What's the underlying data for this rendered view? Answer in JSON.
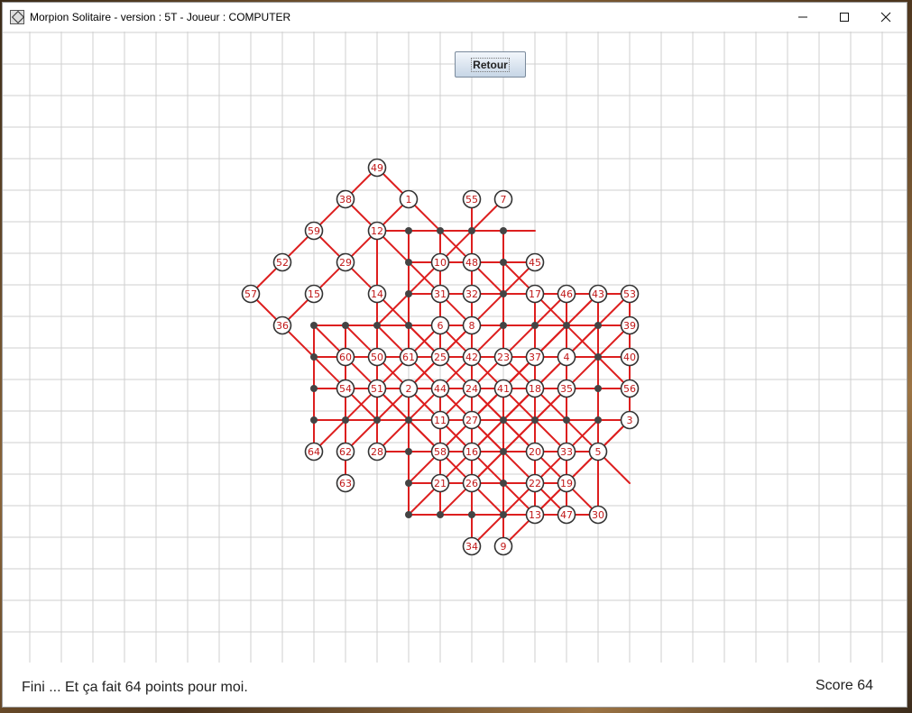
{
  "window": {
    "title": "Morpion Solitaire - version : 5T - Joueur : COMPUTER"
  },
  "toolbar": {
    "retour_label": "Retour"
  },
  "status": {
    "message": "Fini ... Et ça fait 64 points pour moi.",
    "score_text": "Score 64"
  },
  "colors": {
    "grid": "#cfcfcf",
    "line": "#dd1f1f",
    "dot": "#444444",
    "numbered_text": "#c01818",
    "circle_outline": "#333333"
  },
  "board": {
    "initial_dots": [
      [
        7,
        0
      ],
      [
        8,
        0
      ],
      [
        7,
        1
      ],
      [
        6,
        2
      ],
      [
        7,
        2
      ],
      [
        8,
        2
      ],
      [
        5,
        3
      ],
      [
        6,
        3
      ],
      [
        8,
        3
      ],
      [
        9,
        3
      ],
      [
        10,
        3
      ],
      [
        11,
        3
      ],
      [
        0,
        4
      ],
      [
        2,
        4
      ],
      [
        5,
        4
      ],
      [
        11,
        4
      ],
      [
        0,
        5
      ],
      [
        1,
        5
      ],
      [
        3,
        5
      ],
      [
        5,
        5
      ],
      [
        6,
        5
      ],
      [
        8,
        5
      ],
      [
        9,
        5
      ],
      [
        10,
        5
      ],
      [
        11,
        5
      ],
      [
        4,
        6
      ],
      [
        7,
        6
      ],
      [
        5,
        7
      ],
      [
        6,
        7
      ],
      [
        7,
        7
      ],
      [
        8,
        7
      ]
    ],
    "moves": [
      {
        "n": 49,
        "x": 2,
        "y": -2
      },
      {
        "n": 38,
        "x": 1,
        "y": -1
      },
      {
        "n": 1,
        "x": 3,
        "y": -1
      },
      {
        "n": 55,
        "x": 5,
        "y": -1
      },
      {
        "n": 7,
        "x": 6,
        "y": -1
      },
      {
        "n": 59,
        "x": 0,
        "y": 0
      },
      {
        "n": 12,
        "x": 2,
        "y": 0
      },
      {
        "n": 52,
        "x": -1,
        "y": 1
      },
      {
        "n": 29,
        "x": 1,
        "y": 1
      },
      {
        "n": 10,
        "x": 4,
        "y": 1
      },
      {
        "n": 48,
        "x": 5,
        "y": 1
      },
      {
        "n": 45,
        "x": 7,
        "y": 1
      },
      {
        "n": 57,
        "x": -2,
        "y": 2
      },
      {
        "n": 15,
        "x": 0,
        "y": 2
      },
      {
        "n": 14,
        "x": 2,
        "y": 2
      },
      {
        "n": 31,
        "x": 4,
        "y": 2
      },
      {
        "n": 32,
        "x": 5,
        "y": 2
      },
      {
        "n": 17,
        "x": 7,
        "y": 2
      },
      {
        "n": 46,
        "x": 8,
        "y": 2
      },
      {
        "n": 43,
        "x": 9,
        "y": 2
      },
      {
        "n": 53,
        "x": 10,
        "y": 2
      },
      {
        "n": 36,
        "x": -1,
        "y": 3
      },
      {
        "n": 6,
        "x": 4,
        "y": 3
      },
      {
        "n": 8,
        "x": 5,
        "y": 3
      },
      {
        "n": 39,
        "x": 10,
        "y": 3
      },
      {
        "n": 60,
        "x": 1,
        "y": 4
      },
      {
        "n": 50,
        "x": 2,
        "y": 4
      },
      {
        "n": 61,
        "x": 3,
        "y": 4
      },
      {
        "n": 25,
        "x": 4,
        "y": 4
      },
      {
        "n": 42,
        "x": 5,
        "y": 4
      },
      {
        "n": 23,
        "x": 6,
        "y": 4
      },
      {
        "n": 37,
        "x": 7,
        "y": 4
      },
      {
        "n": 4,
        "x": 8,
        "y": 4
      },
      {
        "n": 40,
        "x": 10,
        "y": 4
      },
      {
        "n": 54,
        "x": 1,
        "y": 5
      },
      {
        "n": 51,
        "x": 2,
        "y": 5
      },
      {
        "n": 2,
        "x": 3,
        "y": 5
      },
      {
        "n": 44,
        "x": 4,
        "y": 5
      },
      {
        "n": 24,
        "x": 5,
        "y": 5
      },
      {
        "n": 41,
        "x": 6,
        "y": 5
      },
      {
        "n": 18,
        "x": 7,
        "y": 5
      },
      {
        "n": 35,
        "x": 8,
        "y": 5
      },
      {
        "n": 56,
        "x": 10,
        "y": 5
      },
      {
        "n": 11,
        "x": 4,
        "y": 6
      },
      {
        "n": 27,
        "x": 5,
        "y": 6
      },
      {
        "n": 3,
        "x": 10,
        "y": 6
      },
      {
        "n": 64,
        "x": 0,
        "y": 7
      },
      {
        "n": 62,
        "x": 1,
        "y": 7
      },
      {
        "n": 28,
        "x": 2,
        "y": 7
      },
      {
        "n": 58,
        "x": 4,
        "y": 7
      },
      {
        "n": 16,
        "x": 5,
        "y": 7
      },
      {
        "n": 20,
        "x": 7,
        "y": 7
      },
      {
        "n": 33,
        "x": 8,
        "y": 7
      },
      {
        "n": 5,
        "x": 9,
        "y": 7
      },
      {
        "n": 63,
        "x": 1,
        "y": 8
      },
      {
        "n": 21,
        "x": 4,
        "y": 8
      },
      {
        "n": 26,
        "x": 5,
        "y": 8
      },
      {
        "n": 22,
        "x": 7,
        "y": 8
      },
      {
        "n": 19,
        "x": 8,
        "y": 8
      },
      {
        "n": 13,
        "x": 7,
        "y": 9
      },
      {
        "n": 47,
        "x": 8,
        "y": 9
      },
      {
        "n": 30,
        "x": 9,
        "y": 9
      },
      {
        "n": 34,
        "x": 5,
        "y": 10
      },
      {
        "n": 9,
        "x": 6,
        "y": 10
      }
    ],
    "extra_dots": [
      [
        3,
        0
      ],
      [
        4,
        0
      ],
      [
        5,
        0
      ],
      [
        6,
        0
      ],
      [
        3,
        1
      ],
      [
        6,
        1
      ],
      [
        3,
        2
      ],
      [
        6,
        2
      ],
      [
        0,
        3
      ],
      [
        1,
        3
      ],
      [
        2,
        3
      ],
      [
        3,
        3
      ],
      [
        6,
        3
      ],
      [
        7,
        3
      ],
      [
        8,
        3
      ],
      [
        9,
        3
      ],
      [
        0,
        4
      ],
      [
        9,
        4
      ],
      [
        0,
        5
      ],
      [
        9,
        5
      ],
      [
        0,
        6
      ],
      [
        1,
        6
      ],
      [
        2,
        6
      ],
      [
        3,
        6
      ],
      [
        6,
        6
      ],
      [
        7,
        6
      ],
      [
        8,
        6
      ],
      [
        9,
        6
      ],
      [
        3,
        7
      ],
      [
        6,
        7
      ],
      [
        3,
        8
      ],
      [
        6,
        8
      ],
      [
        3,
        9
      ],
      [
        4,
        9
      ],
      [
        5,
        9
      ],
      [
        6,
        9
      ]
    ],
    "lines": [
      [
        [
          -2,
          2
        ],
        [
          2,
          -2
        ]
      ],
      [
        [
          2,
          -2
        ],
        [
          6,
          2
        ]
      ],
      [
        [
          -2,
          2
        ],
        [
          2,
          6
        ]
      ],
      [
        [
          0,
          0
        ],
        [
          4,
          4
        ]
      ],
      [
        [
          1,
          -1
        ],
        [
          5,
          3
        ]
      ],
      [
        [
          3,
          -1
        ],
        [
          -1,
          3
        ]
      ],
      [
        [
          2,
          0
        ],
        [
          2,
          4
        ]
      ],
      [
        [
          2,
          0
        ],
        [
          6,
          0
        ]
      ],
      [
        [
          3,
          0
        ],
        [
          3,
          4
        ]
      ],
      [
        [
          3,
          0
        ],
        [
          7,
          0
        ]
      ],
      [
        [
          4,
          0
        ],
        [
          4,
          4
        ]
      ],
      [
        [
          6,
          0
        ],
        [
          6,
          4
        ]
      ],
      [
        [
          6,
          -1
        ],
        [
          2,
          3
        ]
      ],
      [
        [
          5,
          -1
        ],
        [
          5,
          3
        ]
      ],
      [
        [
          3,
          1
        ],
        [
          7,
          1
        ]
      ],
      [
        [
          3,
          2
        ],
        [
          7,
          2
        ]
      ],
      [
        [
          6,
          2
        ],
        [
          10,
          2
        ]
      ],
      [
        [
          7,
          2
        ],
        [
          7,
          6
        ]
      ],
      [
        [
          8,
          2
        ],
        [
          8,
          6
        ]
      ],
      [
        [
          9,
          2
        ],
        [
          9,
          6
        ]
      ],
      [
        [
          10,
          2
        ],
        [
          10,
          6
        ]
      ],
      [
        [
          10,
          2
        ],
        [
          6,
          6
        ]
      ],
      [
        [
          9,
          2
        ],
        [
          5,
          6
        ]
      ],
      [
        [
          8,
          2
        ],
        [
          4,
          6
        ]
      ],
      [
        [
          6,
          1
        ],
        [
          10,
          5
        ]
      ],
      [
        [
          7,
          1
        ],
        [
          3,
          5
        ]
      ],
      [
        [
          0,
          3
        ],
        [
          4,
          3
        ]
      ],
      [
        [
          3,
          3
        ],
        [
          7,
          3
        ]
      ],
      [
        [
          6,
          3
        ],
        [
          10,
          3
        ]
      ],
      [
        [
          0,
          4
        ],
        [
          4,
          4
        ]
      ],
      [
        [
          4,
          4
        ],
        [
          8,
          4
        ]
      ],
      [
        [
          6,
          4
        ],
        [
          10,
          4
        ]
      ],
      [
        [
          0,
          5
        ],
        [
          4,
          5
        ]
      ],
      [
        [
          4,
          5
        ],
        [
          8,
          5
        ]
      ],
      [
        [
          6,
          5
        ],
        [
          10,
          5
        ]
      ],
      [
        [
          0,
          6
        ],
        [
          4,
          6
        ]
      ],
      [
        [
          3,
          6
        ],
        [
          7,
          6
        ]
      ],
      [
        [
          6,
          6
        ],
        [
          10,
          6
        ]
      ],
      [
        [
          0,
          3
        ],
        [
          0,
          7
        ]
      ],
      [
        [
          1,
          3
        ],
        [
          1,
          7
        ]
      ],
      [
        [
          1,
          4
        ],
        [
          1,
          8
        ]
      ],
      [
        [
          3,
          5
        ],
        [
          3,
          9
        ]
      ],
      [
        [
          4,
          5
        ],
        [
          4,
          9
        ]
      ],
      [
        [
          5,
          3
        ],
        [
          5,
          7
        ]
      ],
      [
        [
          5,
          6
        ],
        [
          5,
          10
        ]
      ],
      [
        [
          6,
          5
        ],
        [
          6,
          9
        ]
      ],
      [
        [
          6,
          6
        ],
        [
          6,
          10
        ]
      ],
      [
        [
          7,
          5
        ],
        [
          7,
          9
        ]
      ],
      [
        [
          8,
          6
        ],
        [
          8,
          9
        ]
      ],
      [
        [
          9,
          6
        ],
        [
          9,
          9
        ]
      ],
      [
        [
          2,
          3
        ],
        [
          2,
          7
        ]
      ],
      [
        [
          0,
          7
        ],
        [
          4,
          3
        ]
      ],
      [
        [
          1,
          7
        ],
        [
          5,
          3
        ]
      ],
      [
        [
          2,
          7
        ],
        [
          6,
          3
        ]
      ],
      [
        [
          4,
          7
        ],
        [
          8,
          3
        ]
      ],
      [
        [
          5,
          7
        ],
        [
          9,
          3
        ]
      ],
      [
        [
          0,
          3
        ],
        [
          4,
          7
        ]
      ],
      [
        [
          1,
          3
        ],
        [
          5,
          7
        ]
      ],
      [
        [
          2,
          3
        ],
        [
          6,
          7
        ]
      ],
      [
        [
          3,
          3
        ],
        [
          7,
          7
        ]
      ],
      [
        [
          4,
          3
        ],
        [
          8,
          7
        ]
      ],
      [
        [
          2,
          5
        ],
        [
          6,
          9
        ]
      ],
      [
        [
          3,
          5
        ],
        [
          7,
          9
        ]
      ],
      [
        [
          4,
          5
        ],
        [
          8,
          9
        ]
      ],
      [
        [
          5,
          5
        ],
        [
          9,
          9
        ]
      ],
      [
        [
          3,
          8
        ],
        [
          7,
          8
        ]
      ],
      [
        [
          4,
          8
        ],
        [
          8,
          8
        ]
      ],
      [
        [
          3,
          9
        ],
        [
          7,
          9
        ]
      ],
      [
        [
          5,
          9
        ],
        [
          9,
          9
        ]
      ],
      [
        [
          2,
          7
        ],
        [
          6,
          7
        ]
      ],
      [
        [
          5,
          7
        ],
        [
          9,
          7
        ]
      ],
      [
        [
          3,
          7
        ],
        [
          7,
          7
        ]
      ],
      [
        [
          5,
          10
        ],
        [
          9,
          6
        ]
      ],
      [
        [
          6,
          10
        ],
        [
          10,
          6
        ]
      ],
      [
        [
          4,
          9
        ],
        [
          8,
          5
        ]
      ],
      [
        [
          3,
          9
        ],
        [
          7,
          5
        ]
      ],
      [
        [
          3,
          8
        ],
        [
          7,
          4
        ]
      ],
      [
        [
          5,
          8
        ],
        [
          9,
          4
        ]
      ],
      [
        [
          7,
          9
        ],
        [
          10,
          6
        ]
      ],
      [
        [
          6,
          4
        ],
        [
          10,
          8
        ]
      ],
      [
        [
          9,
          4
        ],
        [
          10,
          3
        ]
      ],
      [
        [
          5,
          6
        ],
        [
          9,
          2
        ]
      ]
    ]
  }
}
